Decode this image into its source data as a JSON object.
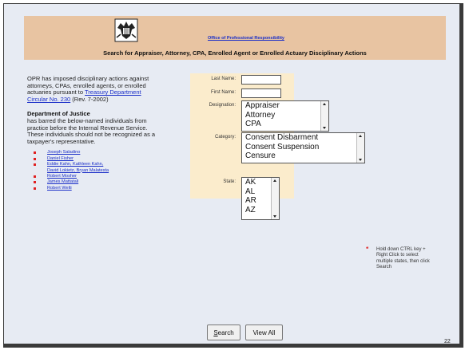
{
  "banner": {
    "logo_icon": "irs-eagle-logo-icon",
    "opr_link": "Office of Professional Responsibility",
    "title": "Search for Appraiser, Attorney, CPA, Enrolled Agent or Enrolled Actuary Disciplinary Actions"
  },
  "intro": {
    "text": "OPR has imposed disciplinary actions against attorneys, CPAs, enrolled agents, or enrolled actuaries pursuant to",
    "link": "Treasury Department Circular No. 230",
    "suffix": " (Rev. 7-2002)"
  },
  "doj": {
    "heading": "Department of Justice",
    "text": "has barred the below-named individuals from practice before the Internal Revenue Service. These individuals should not be recognized as a taxpayer's representative."
  },
  "barred_names": [
    "Joseph Saladino",
    "Daniel Fisher",
    "Eddie Kahn, Kathleen Kahn,",
    "David Lokietz, Bryan Malatesta",
    "Robert Mosher",
    "James Mattatall",
    "Robert Welti"
  ],
  "form": {
    "last_name_label": "Last Name:",
    "last_name_value": "",
    "first_name_label": "First Name:",
    "first_name_value": "",
    "designation_label": "Designation:",
    "designation_options": [
      "Appraiser",
      "Attorney",
      "CPA"
    ],
    "category_label": "Category:",
    "category_options": [
      "Consent Disbarment",
      "Consent Suspension",
      "Censure"
    ],
    "state_label": "State:",
    "state_options": [
      "AK",
      "AL",
      "AR",
      "AZ"
    ]
  },
  "hint": "Hold down CTRL key + Right Click to select multiple states, then click Search",
  "buttons": {
    "search_label": "Search",
    "search_accesskey": "S",
    "view_all_label": "View All"
  },
  "page_number": "22",
  "colors": {
    "banner": "#e8c4a2",
    "form_panel": "#fbeccc",
    "link": "#1a2ec8",
    "bullet": "#e02020",
    "slide_bg": "#e7ebf3"
  }
}
